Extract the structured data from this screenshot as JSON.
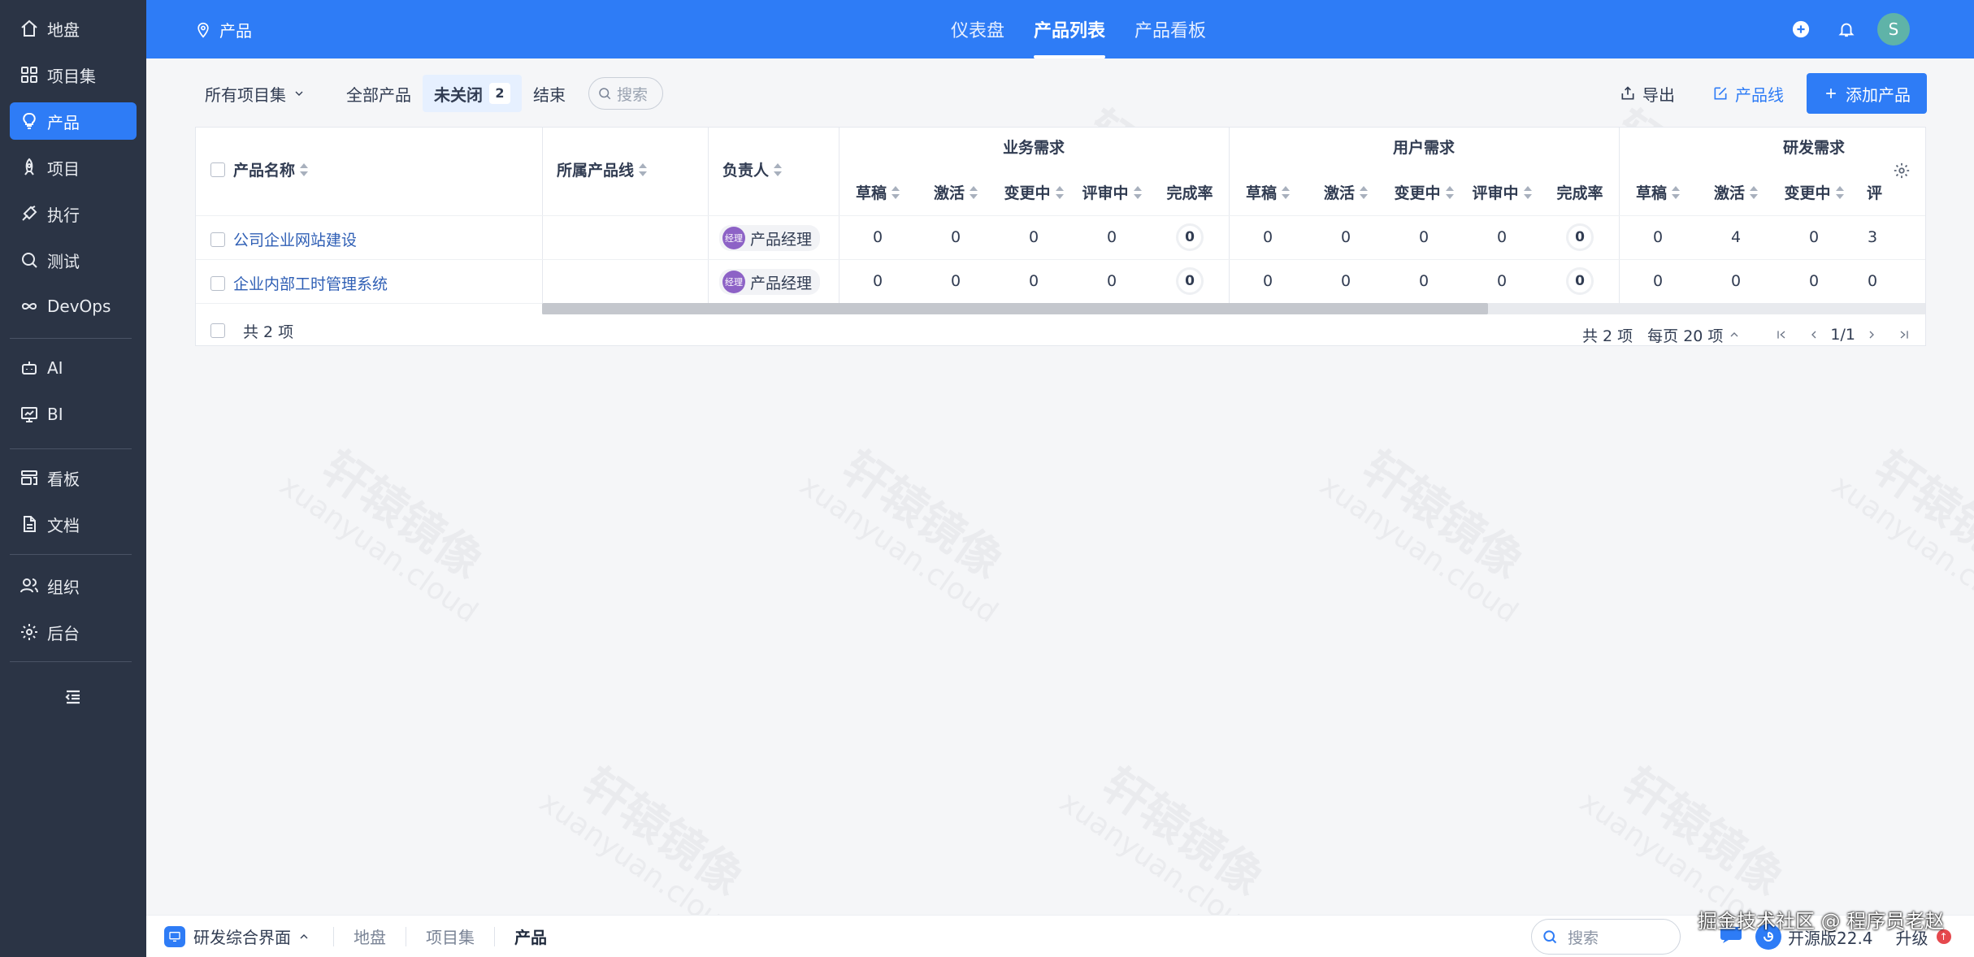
{
  "sidebar": {
    "items": [
      {
        "label": "地盘",
        "icon": "home-icon"
      },
      {
        "label": "项目集",
        "icon": "grid-icon"
      },
      {
        "label": "产品",
        "icon": "lightbulb-icon",
        "active": true
      },
      {
        "label": "项目",
        "icon": "rocket-icon"
      },
      {
        "label": "执行",
        "icon": "run-icon"
      },
      {
        "label": "测试",
        "icon": "magnifier-icon"
      },
      {
        "label": "DevOps",
        "icon": "infinity-icon"
      },
      {
        "label": "AI",
        "icon": "robot-icon"
      },
      {
        "label": "BI",
        "icon": "chart-icon"
      },
      {
        "label": "看板",
        "icon": "board-icon"
      },
      {
        "label": "文档",
        "icon": "document-icon"
      },
      {
        "label": "组织",
        "icon": "people-icon"
      },
      {
        "label": "后台",
        "icon": "gear-icon"
      }
    ]
  },
  "header": {
    "location": "产品",
    "tabs": [
      {
        "label": "仪表盘",
        "active": false
      },
      {
        "label": "产品列表",
        "active": true
      },
      {
        "label": "产品看板",
        "active": false
      }
    ],
    "avatar": "S",
    "accent": "#2e7cf6"
  },
  "toolbar": {
    "program_filter": "所有项目集",
    "filters": [
      {
        "label": "全部产品",
        "selected": false
      },
      {
        "label": "未关闭",
        "selected": true,
        "count": "2"
      },
      {
        "label": "结束",
        "selected": false
      }
    ],
    "search_placeholder": "搜索",
    "export_label": "导出",
    "productline_label": "产品线",
    "add_label": "添加产品"
  },
  "table": {
    "col_name": "产品名称",
    "col_line": "所属产品线",
    "col_owner": "负责人",
    "groups": [
      "业务需求",
      "用户需求",
      "研发需求"
    ],
    "sub_cols": [
      "草稿",
      "激活",
      "变更中",
      "评审中",
      "完成率"
    ],
    "last_sub_cols": [
      "草稿",
      "激活",
      "变更中",
      "评"
    ],
    "rows": [
      {
        "name": "公司企业网站建设",
        "line": "",
        "owner_avatar": "经理",
        "owner": "产品经理",
        "biz": [
          "0",
          "0",
          "0",
          "0",
          "0"
        ],
        "user": [
          "0",
          "0",
          "0",
          "0",
          "0"
        ],
        "dev": [
          "0",
          "4",
          "0",
          "3"
        ]
      },
      {
        "name": "企业内部工时管理系统",
        "line": "",
        "owner_avatar": "经理",
        "owner": "产品经理",
        "biz": [
          "0",
          "0",
          "0",
          "0",
          "0"
        ],
        "user": [
          "0",
          "0",
          "0",
          "0",
          "0"
        ],
        "dev": [
          "0",
          "0",
          "0",
          "0"
        ]
      }
    ],
    "footer_total": "共 2 项",
    "pager_total": "共 2 项",
    "pager_size": "每页 20 项",
    "pager_page": "1/1"
  },
  "bottombar": {
    "app": "研发综合界面",
    "crumbs": [
      "地盘",
      "项目集",
      "产品"
    ],
    "search_placeholder": "搜索",
    "version": "开源版22.4",
    "upgrade": "升级"
  },
  "watermark": {
    "cn": "轩辕镜像",
    "en": "xuanyuan.cloud"
  },
  "credit": "掘金技术社区 @ 程序员老赵"
}
